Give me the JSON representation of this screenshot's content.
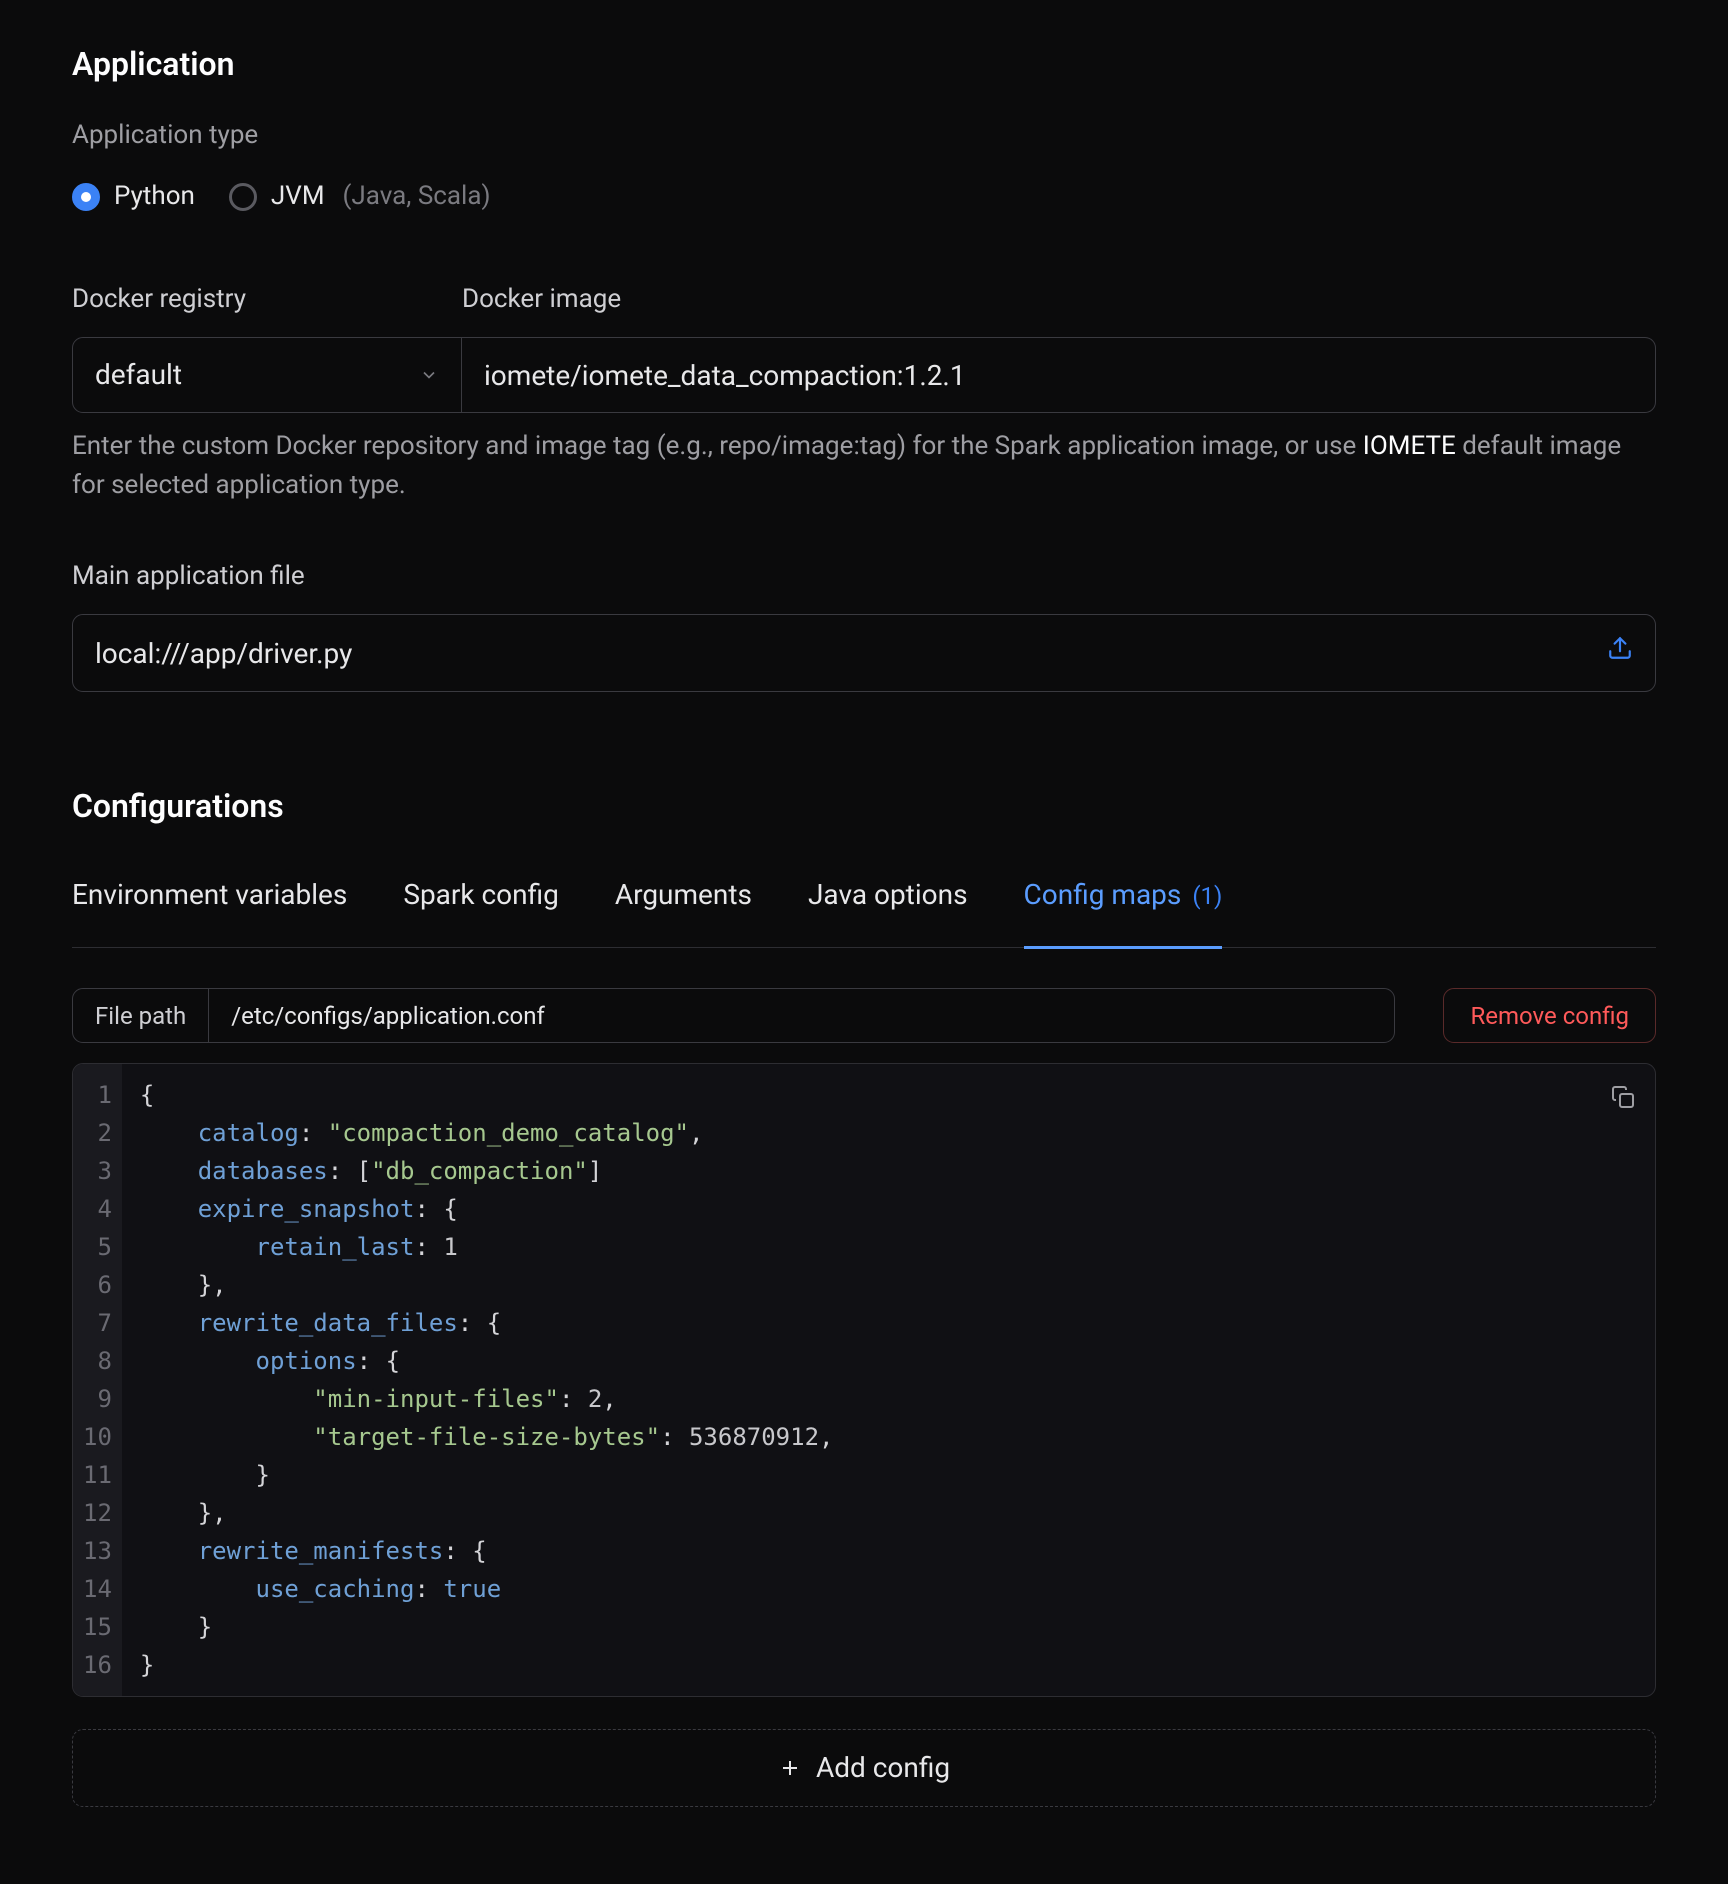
{
  "application": {
    "heading": "Application",
    "type_label": "Application type",
    "options": {
      "python": "Python",
      "jvm": "JVM",
      "jvm_hint": "(Java, Scala)"
    },
    "docker_registry_label": "Docker registry",
    "docker_registry_value": "default",
    "docker_image_label": "Docker image",
    "docker_image_value": "iomete/iomete_data_compaction:1.2.1",
    "helper_pre": "Enter the custom Docker repository and image tag (e.g., repo/image:tag) for the Spark application image, or use ",
    "helper_emph": "IOMETE",
    "helper_post": " default image for selected application type.",
    "main_file_label": "Main application file",
    "main_file_value": "local:///app/driver.py"
  },
  "configurations": {
    "heading": "Configurations",
    "tabs": {
      "env": "Environment variables",
      "spark": "Spark config",
      "args": "Arguments",
      "java": "Java options",
      "maps": "Config maps",
      "maps_count": "(1)"
    },
    "file_path_label": "File path",
    "file_path_value": "/etc/configs/application.conf",
    "remove_label": "Remove config",
    "code_lines": [
      "1",
      "2",
      "3",
      "4",
      "5",
      "6",
      "7",
      "8",
      "9",
      "10",
      "11",
      "12",
      "13",
      "14",
      "15",
      "16"
    ],
    "config_content": {
      "catalog": "compaction_demo_catalog",
      "databases": [
        "db_compaction"
      ],
      "expire_snapshot": {
        "retain_last": 1
      },
      "rewrite_data_files": {
        "options": {
          "min-input-files": 2,
          "target-file-size-bytes": 536870912
        }
      },
      "rewrite_manifests": {
        "use_caching": true
      }
    },
    "add_config_label": "Add config"
  }
}
